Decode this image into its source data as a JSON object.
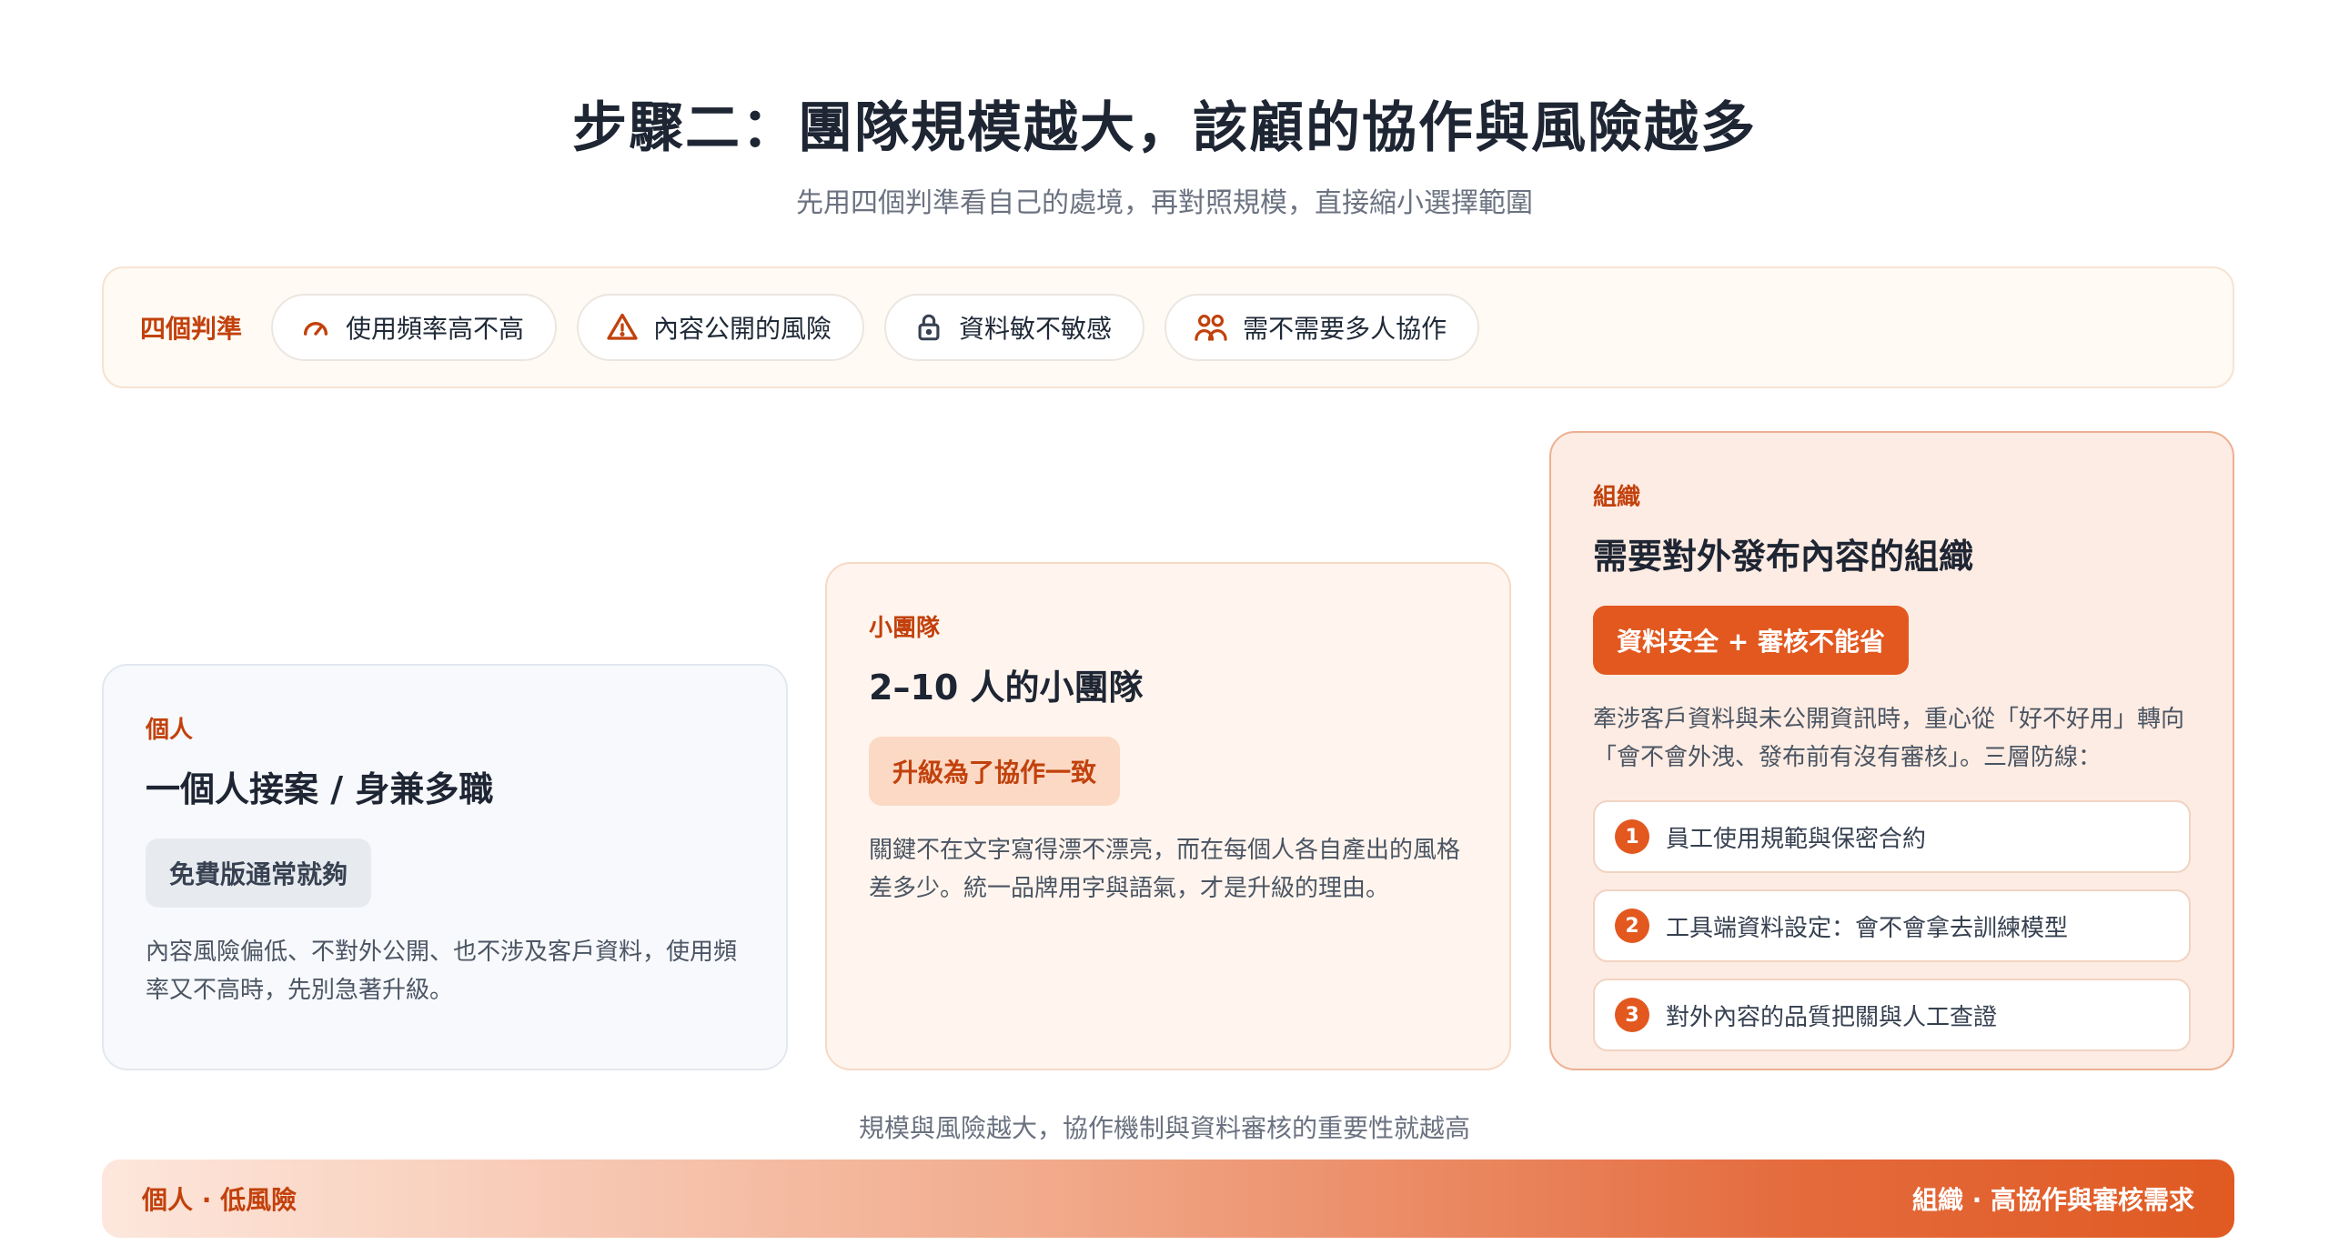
{
  "header": {
    "title": "步驟二：團隊規模越大，該顧的協作與風險越多",
    "subtitle": "先用四個判準看自己的處境，再對照規模，直接縮小選擇範圍"
  },
  "criteria": {
    "label": "四個判準",
    "items": [
      {
        "label": "使用頻率高不高",
        "icon": "gauge-icon"
      },
      {
        "label": "內容公開的風險",
        "icon": "warning-icon"
      },
      {
        "label": "資料敏不敏感",
        "icon": "lock-icon"
      },
      {
        "label": "需不需要多人協作",
        "icon": "users-icon"
      }
    ]
  },
  "cards": {
    "personal": {
      "tag": "個人",
      "title": "一個人接案 / 身兼多職",
      "badge": "免費版通常就夠",
      "desc": "內容風險偏低、不對外公開、也不涉及客戶資料，使用頻率又不高時，先別急著升級。"
    },
    "team": {
      "tag": "小團隊",
      "title": "2–10 人的小團隊",
      "badge": "升級為了協作一致",
      "desc": "關鍵不在文字寫得漂不漂亮，而在每個人各自產出的風格差多少。統一品牌用字與語氣，才是升級的理由。"
    },
    "org": {
      "tag": "組織",
      "title": "需要對外發布內容的組織",
      "badge": "資料安全 + 審核不能省",
      "desc": "牽涉客戶資料與未公開資訊時，重心從「好不好用」轉向「會不會外洩、發布前有沒有審核」。三層防線：",
      "layers": [
        {
          "num": "1",
          "label": "員工使用規範與保密合約"
        },
        {
          "num": "2",
          "label": "工具端資料設定：會不會拿去訓練模型"
        },
        {
          "num": "3",
          "label": "對外內容的品質把關與人工查證"
        }
      ]
    }
  },
  "scale": {
    "caption": "規模與風險越大，協作機制與資料審核的重要性就越高",
    "left": "個人 · 低風險",
    "right": "組織 · 高協作與審核需求"
  },
  "colors": {
    "accent": "#e2581f",
    "accent_text": "#c2410c",
    "title": "#1e2533"
  }
}
